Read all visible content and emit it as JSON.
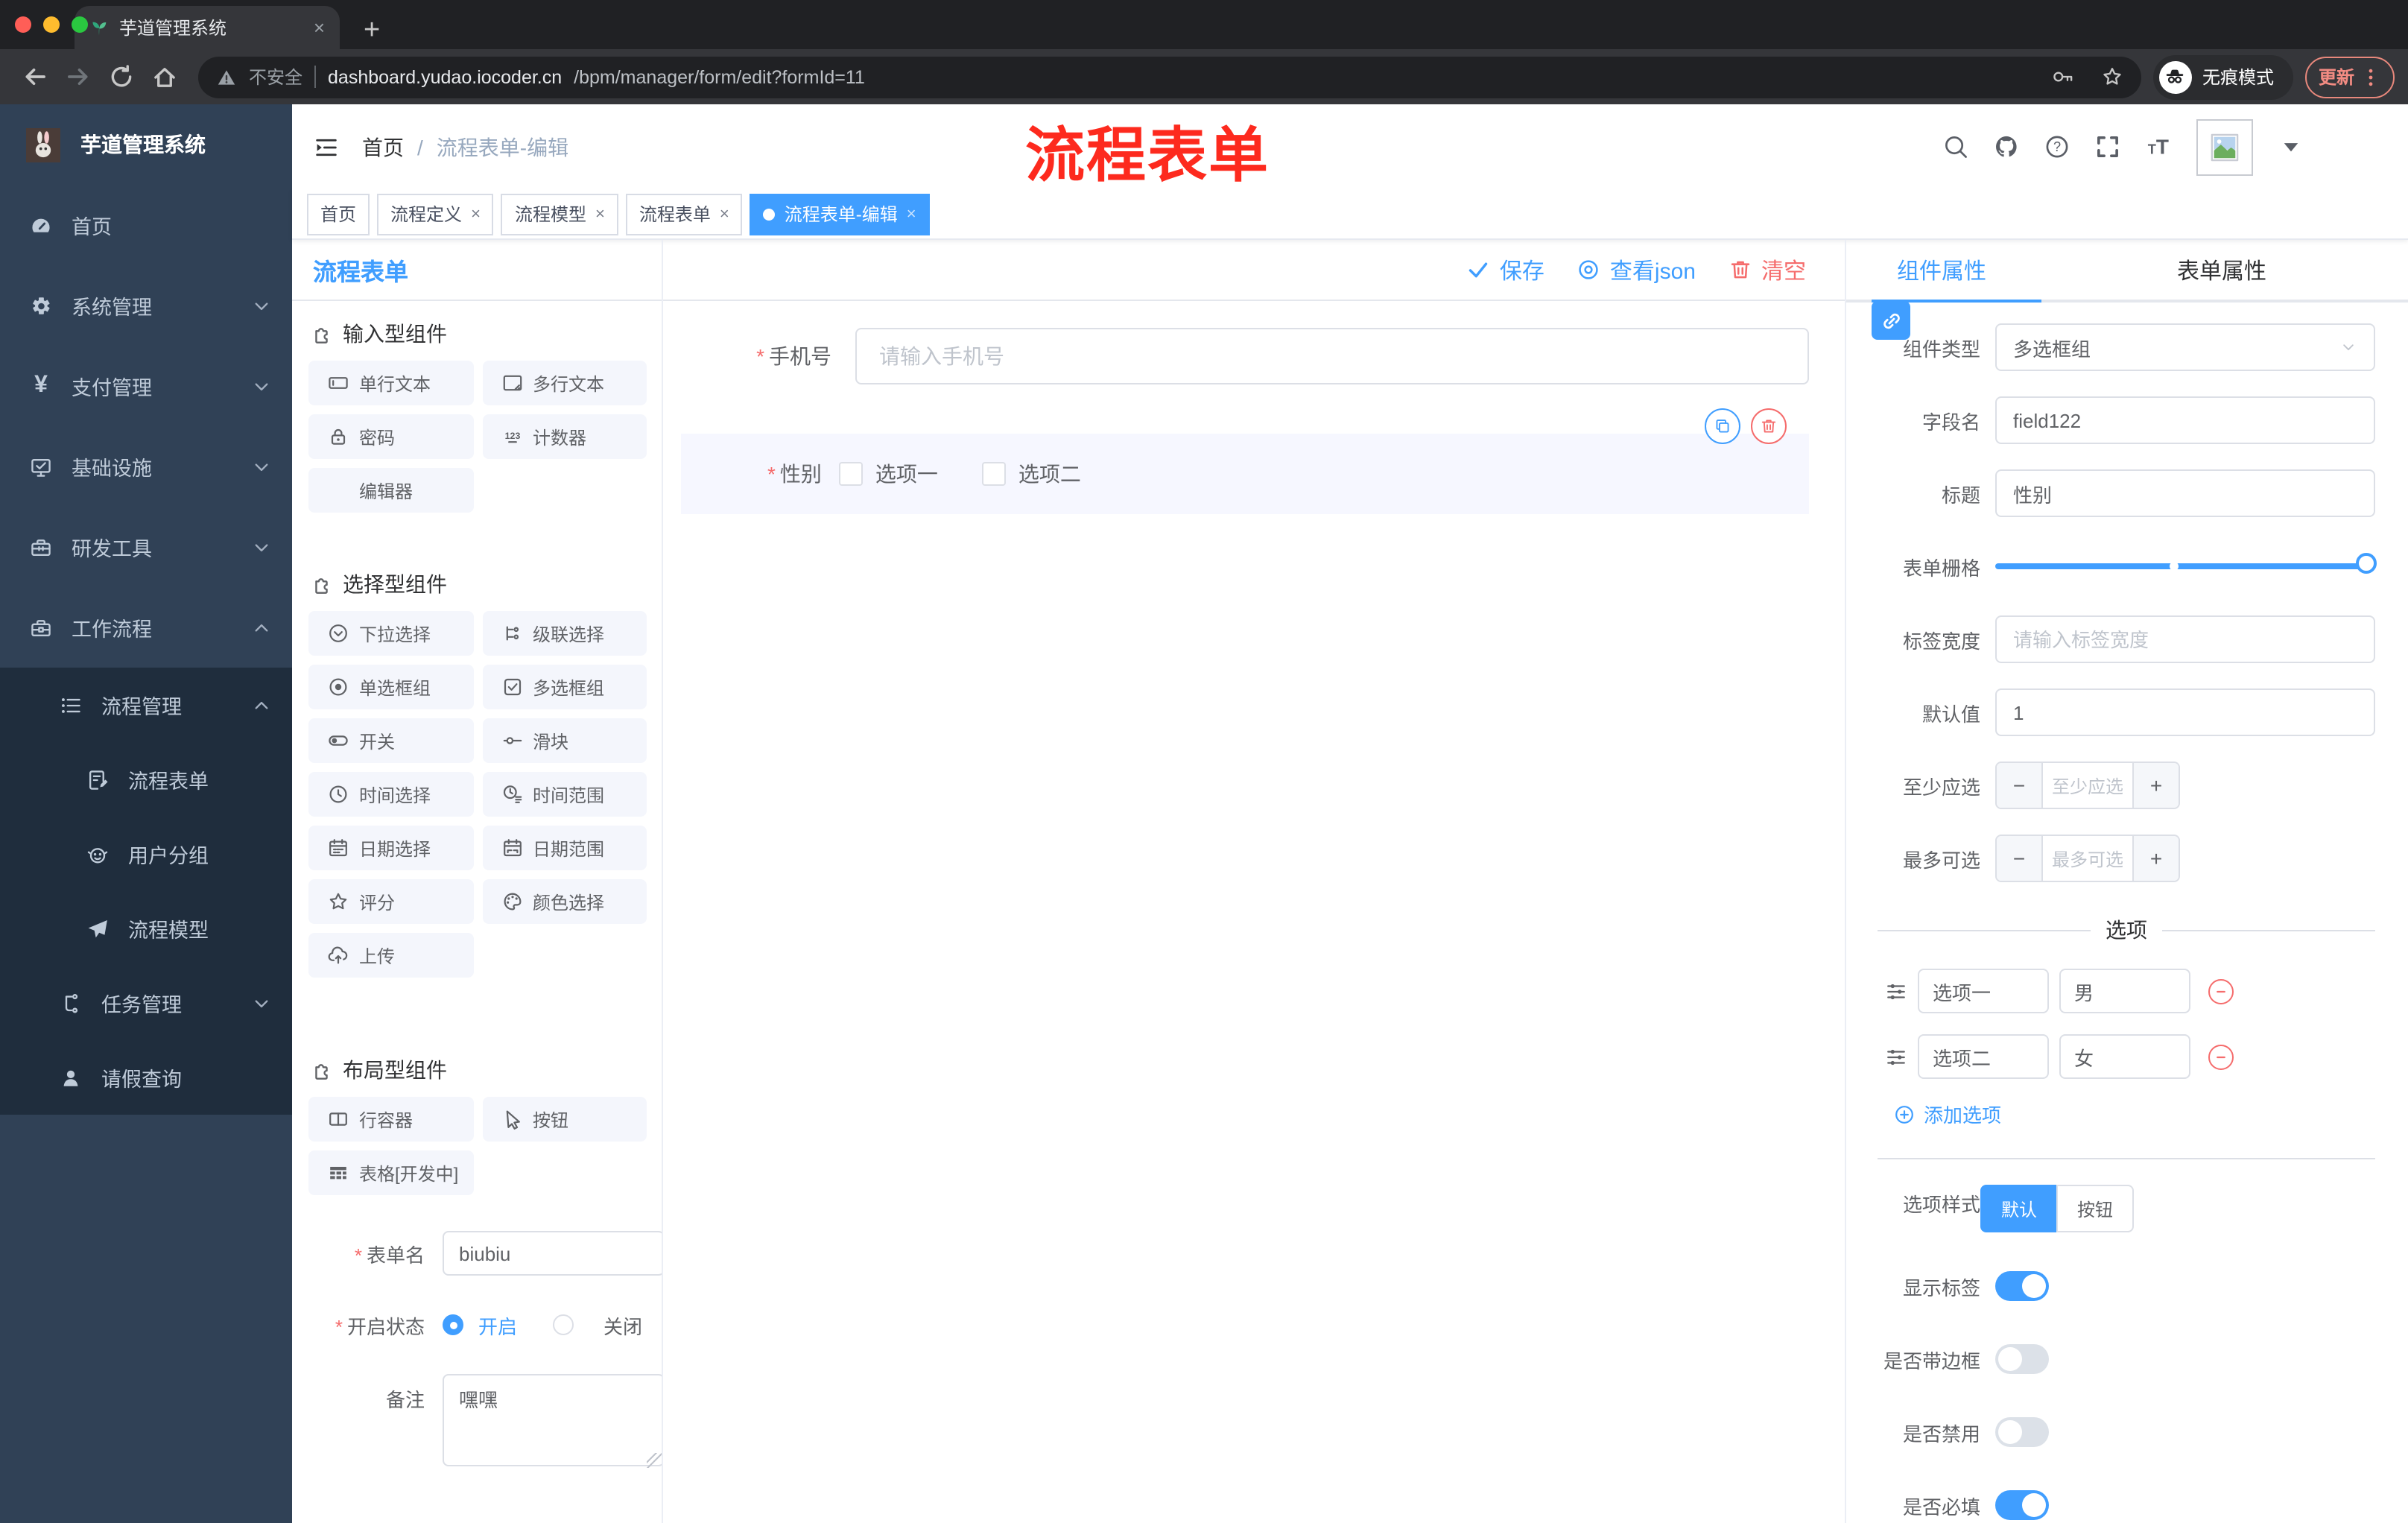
{
  "browser": {
    "tab_title": "芋道管理系统",
    "security_label": "不安全",
    "url_host": "dashboard.yudao.iocoder.cn",
    "url_path": "/bpm/manager/form/edit?formId=11",
    "incognito_label": "无痕模式",
    "update_label": "更新"
  },
  "sidebar": {
    "logo_title": "芋道管理系统",
    "menu": [
      {
        "label": "首页",
        "icon": "gauge",
        "level": 1,
        "chevron": null,
        "submenu": false
      },
      {
        "label": "系统管理",
        "icon": "gear",
        "level": 1,
        "chevron": "down",
        "submenu": false
      },
      {
        "label": "支付管理",
        "icon": "yen",
        "level": 1,
        "chevron": "down",
        "submenu": false
      },
      {
        "label": "基础设施",
        "icon": "monitor",
        "level": 1,
        "chevron": "down",
        "submenu": false
      },
      {
        "label": "研发工具",
        "icon": "toolbox",
        "level": 1,
        "chevron": "down",
        "submenu": false
      },
      {
        "label": "工作流程",
        "icon": "briefcase",
        "level": 1,
        "chevron": "up",
        "submenu": false
      },
      {
        "label": "流程管理",
        "icon": "list",
        "level": 2,
        "chevron": "up",
        "submenu": true
      },
      {
        "label": "流程表单",
        "icon": "doc-edit",
        "level": 3,
        "chevron": null,
        "submenu": true
      },
      {
        "label": "用户分组",
        "icon": "robot",
        "level": 3,
        "chevron": null,
        "submenu": true
      },
      {
        "label": "流程模型",
        "icon": "plane",
        "level": 3,
        "chevron": null,
        "submenu": true
      },
      {
        "label": "任务管理",
        "icon": "tree",
        "level": 2,
        "chevron": "down",
        "submenu": true
      },
      {
        "label": "请假查询",
        "icon": "user",
        "level": 2,
        "chevron": null,
        "submenu": true
      }
    ]
  },
  "navbar": {
    "breadcrumb_home": "首页",
    "breadcrumb_sep": "/",
    "breadcrumb_current": "流程表单-编辑",
    "annotation": "流程表单"
  },
  "tags": [
    {
      "label": "首页",
      "closable": false,
      "active": false
    },
    {
      "label": "流程定义",
      "closable": true,
      "active": false
    },
    {
      "label": "流程模型",
      "closable": true,
      "active": false
    },
    {
      "label": "流程表单",
      "closable": true,
      "active": false
    },
    {
      "label": "流程表单-编辑",
      "closable": true,
      "active": true
    }
  ],
  "palette": {
    "title": "流程表单",
    "sections": [
      {
        "title": "输入型组件",
        "items": [
          {
            "label": "单行文本",
            "icon": "input"
          },
          {
            "label": "多行文本",
            "icon": "textarea"
          },
          {
            "label": "密码",
            "icon": "lock"
          },
          {
            "label": "计数器",
            "icon": "counter"
          },
          {
            "label": "编辑器",
            "icon": null
          }
        ]
      },
      {
        "title": "选择型组件",
        "items": [
          {
            "label": "下拉选择",
            "icon": "select"
          },
          {
            "label": "级联选择",
            "icon": "cascader"
          },
          {
            "label": "单选框组",
            "icon": "radio"
          },
          {
            "label": "多选框组",
            "icon": "checkbox"
          },
          {
            "label": "开关",
            "icon": "switch"
          },
          {
            "label": "滑块",
            "icon": "slider"
          },
          {
            "label": "时间选择",
            "icon": "time"
          },
          {
            "label": "时间范围",
            "icon": "time-range"
          },
          {
            "label": "日期选择",
            "icon": "date"
          },
          {
            "label": "日期范围",
            "icon": "date-range"
          },
          {
            "label": "评分",
            "icon": "star"
          },
          {
            "label": "颜色选择",
            "icon": "palette"
          },
          {
            "label": "上传",
            "icon": "upload"
          }
        ]
      },
      {
        "title": "布局型组件",
        "items": [
          {
            "label": "行容器",
            "icon": "row"
          },
          {
            "label": "按钮",
            "icon": "pointer"
          },
          {
            "label": "表格[开发中]",
            "icon": "table"
          }
        ]
      }
    ],
    "meta": {
      "form_name_label": "表单名",
      "form_name_value": "biubiu",
      "status_label": "开启状态",
      "status_on": "开启",
      "status_off": "关闭",
      "remark_label": "备注",
      "remark_value": "嘿嘿"
    }
  },
  "canvas": {
    "save_label": "保存",
    "view_json_label": "查看json",
    "clear_label": "清空",
    "phone_field": {
      "label": "手机号",
      "placeholder": "请输入手机号"
    },
    "gender_field": {
      "label": "性别",
      "options": [
        "选项一",
        "选项二"
      ]
    }
  },
  "props": {
    "tabs": [
      "组件属性",
      "表单属性"
    ],
    "active_tab": "组件属性",
    "component_type_label": "组件类型",
    "component_type_value": "多选框组",
    "field_name_label": "字段名",
    "field_name_value": "field122",
    "title_label": "标题",
    "title_value": "性别",
    "grid_label": "表单栅格",
    "grid_percent": 100,
    "grid_mark_percent": 47,
    "label_width_label": "标签宽度",
    "label_width_placeholder": "请输入标签宽度",
    "default_label": "默认值",
    "default_value": "1",
    "min_label": "至少应选",
    "min_placeholder": "至少应选",
    "max_label": "最多可选",
    "max_placeholder": "最多可选",
    "options_title": "选项",
    "options": [
      {
        "name": "选项一",
        "value": "男"
      },
      {
        "name": "选项二",
        "value": "女"
      }
    ],
    "add_option_label": "添加选项",
    "style_label": "选项样式",
    "style_options": [
      "默认",
      "按钮"
    ],
    "style_active": "默认",
    "toggles": [
      {
        "label": "显示标签",
        "on": true
      },
      {
        "label": "是否带边框",
        "on": false
      },
      {
        "label": "是否禁用",
        "on": false
      },
      {
        "label": "是否必填",
        "on": true
      }
    ]
  },
  "colors": {
    "accent": "#409eff",
    "danger": "#f56c6c",
    "sidebar_bg": "#304156",
    "submenu_bg": "#1f2d3d"
  }
}
